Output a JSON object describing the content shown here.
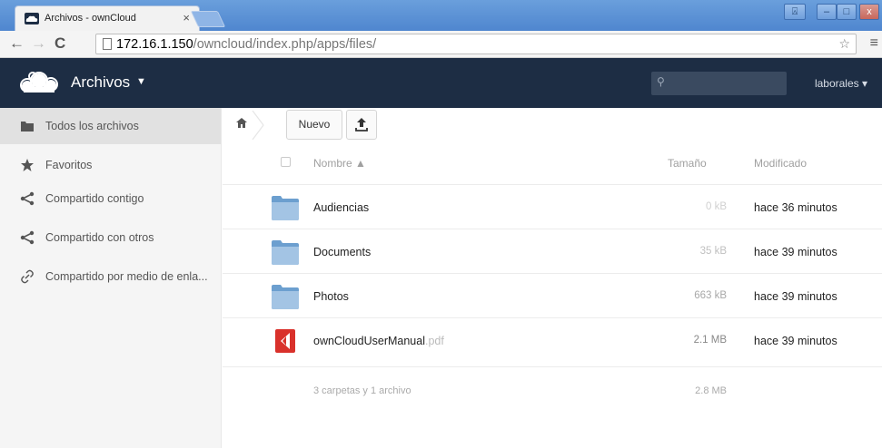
{
  "browser": {
    "tab_title": "Archivos - ownCloud",
    "tab_close": "×",
    "url_host": "172.16.1.150",
    "url_path": "/owncloud/index.php/apps/files/",
    "window_controls": [
      "⍓",
      "–",
      "□",
      "x"
    ]
  },
  "header": {
    "app_name": "Archivos",
    "caret": "▼",
    "search_placeholder": "",
    "user": "laborales ▾"
  },
  "sidebar": {
    "items": [
      {
        "label": "Todos los archivos",
        "icon": "folder-icon",
        "active": true
      },
      {
        "label": "Favoritos",
        "icon": "star-icon",
        "active": false
      },
      {
        "label": "Compartido contigo",
        "icon": "share-icon",
        "active": false
      },
      {
        "label": "Compartido con otros",
        "icon": "share-icon",
        "active": false
      },
      {
        "label": "Compartido por medio de enla...",
        "icon": "link-icon",
        "active": false
      }
    ]
  },
  "controls": {
    "new_label": "Nuevo"
  },
  "table": {
    "columns": {
      "name": "Nombre ▲",
      "size": "Tamaño",
      "modified": "Modificado"
    },
    "rows": [
      {
        "name": "Audiencias",
        "ext": "",
        "type": "folder",
        "size": "0 kB",
        "size_color": "#d0d0d0",
        "modified": "hace 36 minutos"
      },
      {
        "name": "Documents",
        "ext": "",
        "type": "folder",
        "size": "35 kB",
        "size_color": "#c0c0c0",
        "modified": "hace 39 minutos"
      },
      {
        "name": "Photos",
        "ext": "",
        "type": "folder",
        "size": "663 kB",
        "size_color": "#a8a8a8",
        "modified": "hace 39 minutos"
      },
      {
        "name": "ownCloudUserManual",
        "ext": ".pdf",
        "type": "pdf",
        "size": "2.1 MB",
        "size_color": "#888888",
        "modified": "hace 39 minutos"
      }
    ],
    "summary": {
      "text": "3 carpetas y 1 archivo",
      "size": "2.8 MB"
    }
  },
  "colors": {
    "header_bg": "#1d2d44",
    "sidebar_bg": "#f5f5f5",
    "active_item_bg": "#e1e1e1",
    "folder_blue": "#8fb5d9",
    "pdf_red": "#d9312b"
  }
}
